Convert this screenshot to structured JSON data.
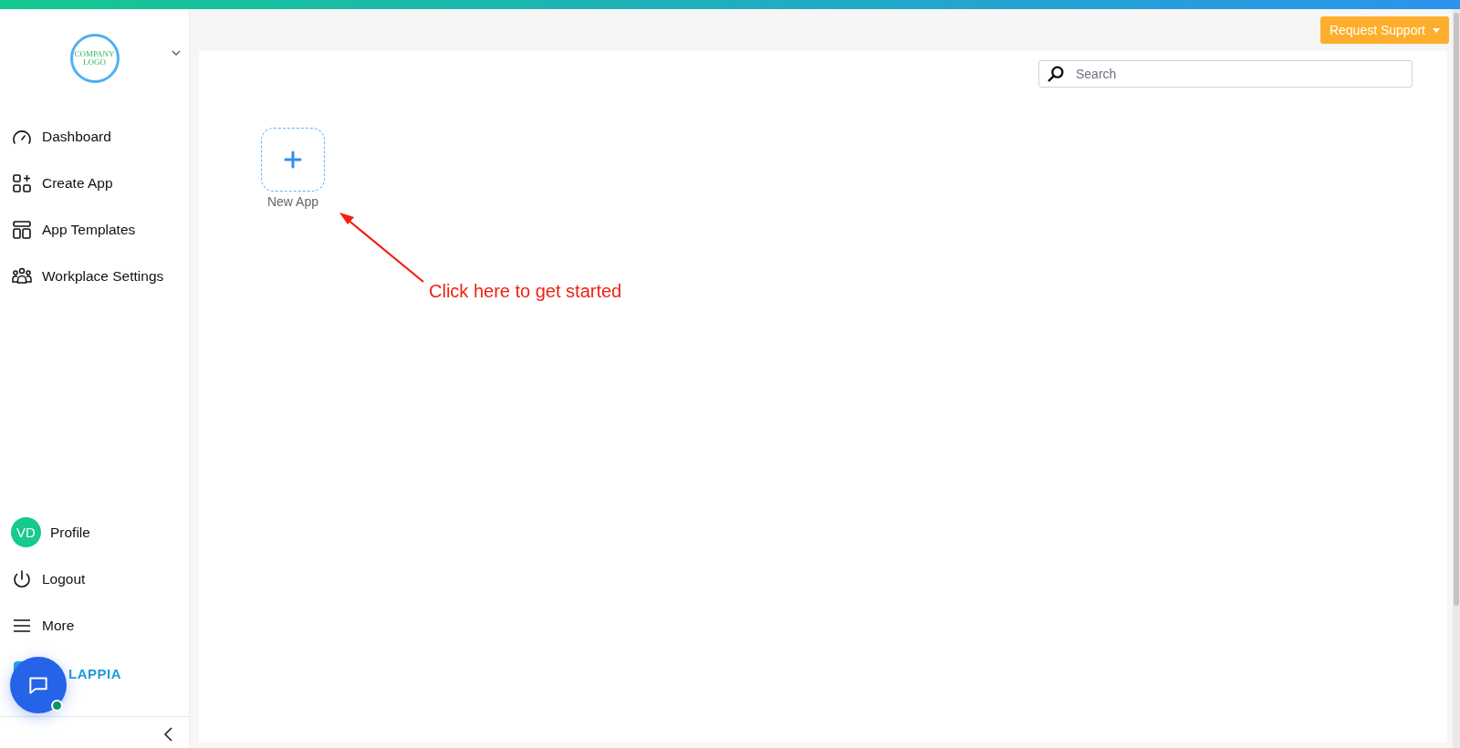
{
  "logo": {
    "line_1": "COMPANY",
    "line_2": "LOGO"
  },
  "sidebar": {
    "items": [
      {
        "kind": "dashboard",
        "label": "Dashboard"
      },
      {
        "kind": "create",
        "label": "Create App"
      },
      {
        "kind": "templates",
        "label": "App Templates"
      },
      {
        "kind": "settings",
        "label": "Workplace Settings"
      }
    ],
    "bottom_items": [
      {
        "kind": "avatar",
        "initials": "VD",
        "label": "Profile"
      },
      {
        "kind": "logout",
        "label": "Logout"
      },
      {
        "kind": "menu",
        "label": "More"
      }
    ],
    "brand": "LAPPIA"
  },
  "header": {
    "button": "Request Support"
  },
  "search": {
    "placeholder": "Search"
  },
  "new_app": {
    "label": "New App"
  },
  "annotation": {
    "text": "Click here to get started"
  },
  "chat": {
    "online": true
  }
}
